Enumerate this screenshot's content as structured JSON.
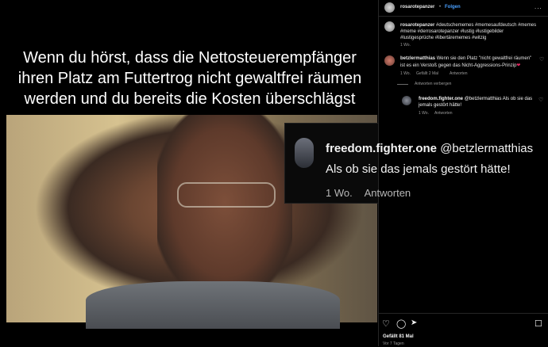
{
  "meme": {
    "caption_line1": "Wenn du hörst, dass die Nettosteuerempfänger",
    "caption_line2": "ihren Platz am Futtertrog nicht gewaltfrei räumen",
    "caption_line3": "werden und du bereits die Kosten überschlägst"
  },
  "quote": {
    "username": "freedom.fighter.one",
    "text": "@betzlermatthias Als ob sie das jemals gestört hätte!",
    "time": "1 Wo.",
    "reply": "Antworten"
  },
  "panel": {
    "header": {
      "username": "rosarotepanzer",
      "separator": "•",
      "follow": "Folgen",
      "more": "..."
    },
    "caption": {
      "username": "rosarotepanzer",
      "line1": "#deutschememes #memesaufdeutsch #memes",
      "line2": "#meme #derrosarotepanzer #lustig #lustigebilder",
      "line3": "#lustigesprüche #libertärememes #witzig",
      "time": "1 Wo."
    },
    "comment1": {
      "username": "betzlermatthias",
      "line1": "Wenn sie den Platz \"nicht gewaltfrei räumen\"",
      "line2": "ist es ein Verstoß gegen das Nicht-Aggressions-Prinzip",
      "time": "1 Wo.",
      "likes": "Gefällt 2 Mal",
      "reply": "Antworten",
      "hide_replies": "Antworten verbergen"
    },
    "reply1": {
      "username": "freedom.fighter.one",
      "line1": "@betzlermatthias Als ob sie das",
      "line2": "jemals gestört hätte!",
      "time": "1 Wo.",
      "reply": "Antworten"
    },
    "footer": {
      "likes": "Gefällt 81 Mal",
      "time": "Vor 7 Tagen"
    }
  },
  "colors": {
    "link_blue": "#4aa0ff",
    "heart_red": "#e0245e",
    "background": "#000000"
  },
  "icons": [
    "heart-icon",
    "comment-icon",
    "share-icon",
    "bookmark-icon",
    "more-icon"
  ]
}
